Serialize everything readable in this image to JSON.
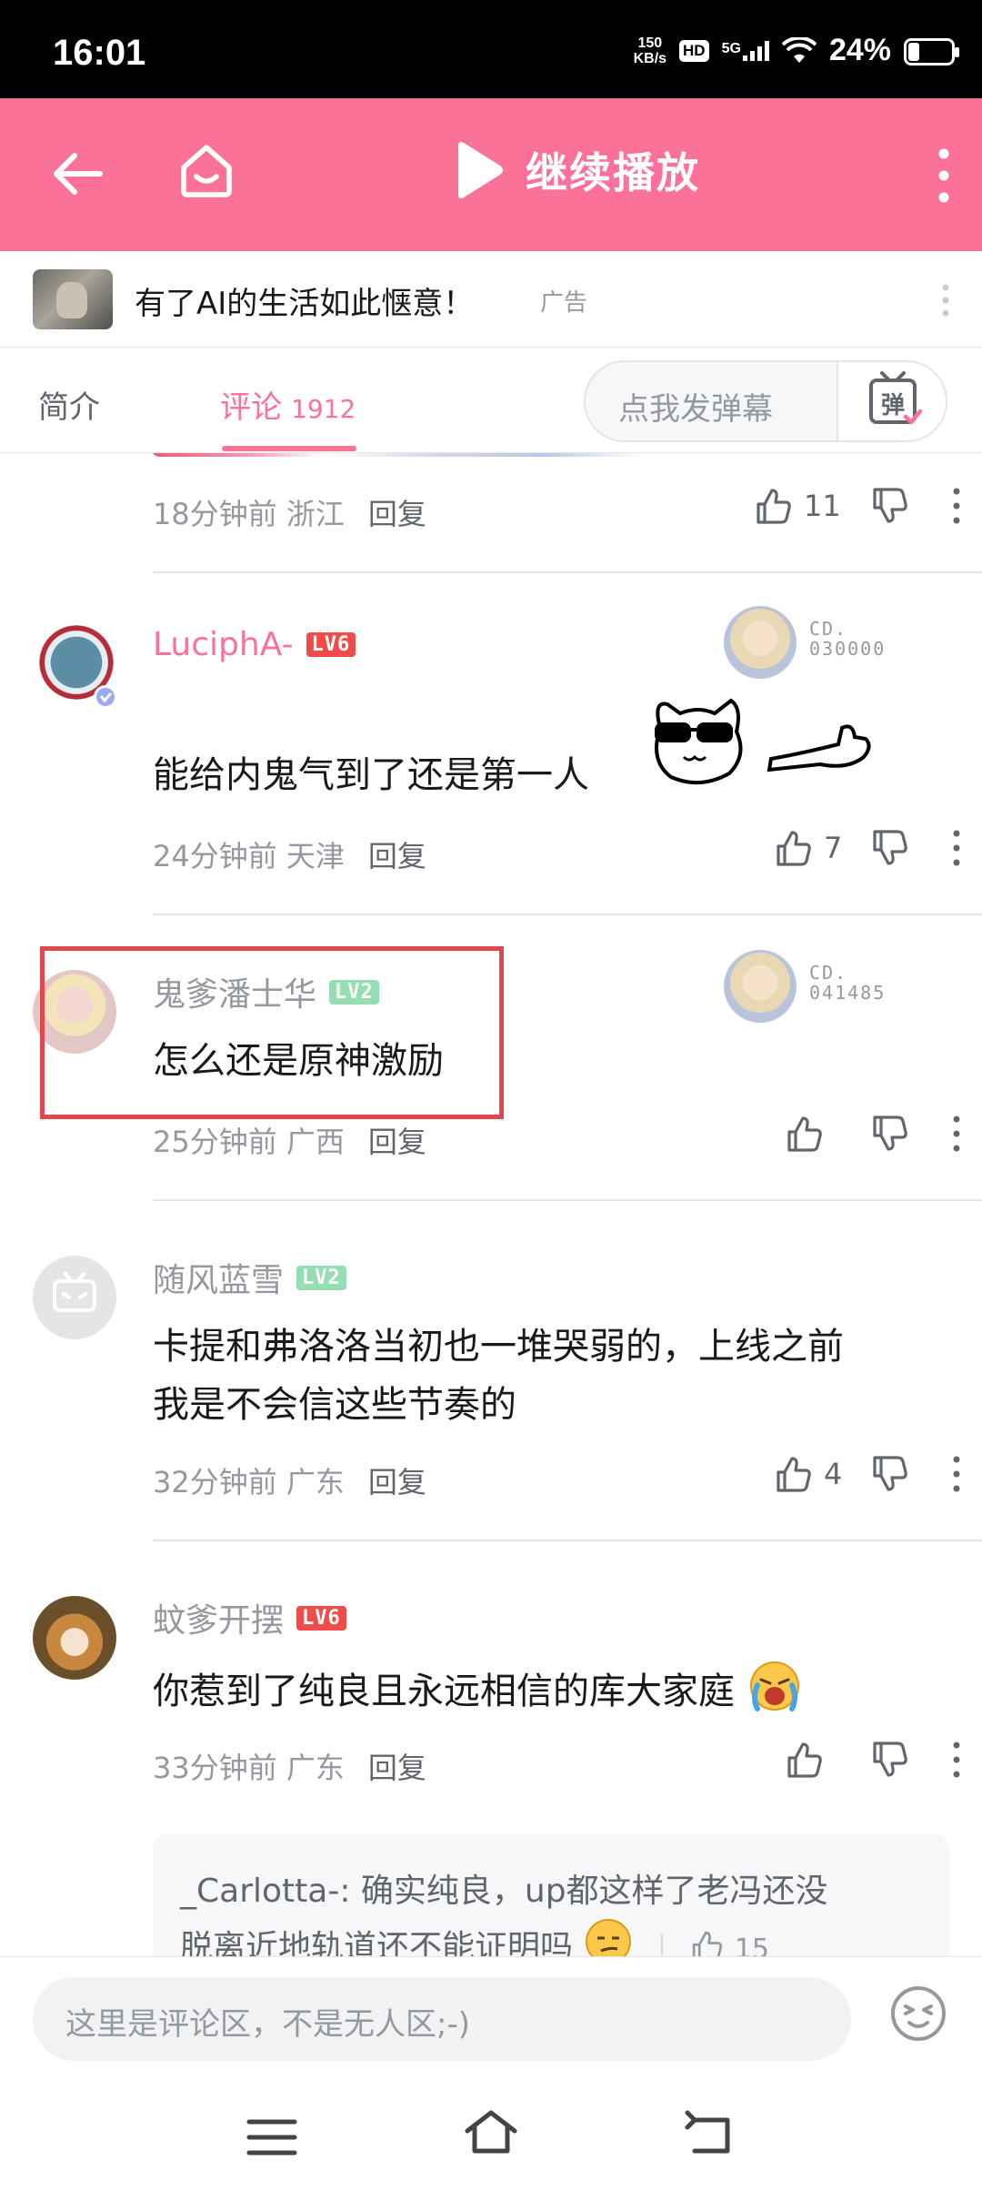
{
  "status_bar": {
    "time": "16:01",
    "net_speed_value": "150",
    "net_speed_unit": "KB/s",
    "hd": "HD",
    "network": "5G",
    "battery": "24%",
    "battery_level": 0.24
  },
  "top_bar": {
    "continue_label": "继续播放",
    "icons": [
      "back-arrow-icon",
      "home-icon",
      "play-icon",
      "more-vertical-icon"
    ]
  },
  "ad": {
    "text": "有了AI的生活如此惬意！",
    "tag": "广告"
  },
  "tabs": {
    "intro": "简介",
    "comments": "评论",
    "comment_count": "1912",
    "danmaku_placeholder": "点我发弹幕",
    "danmaku_button": "弹"
  },
  "comments": [
    {
      "time": "18分钟前 浙江",
      "reply": "回复",
      "likes": "11"
    },
    {
      "username": "LuciphA-",
      "level": "LV6",
      "text": "能给内鬼气到了还是第一人",
      "time": "24分钟前 天津",
      "reply": "回复",
      "likes": "7",
      "fan_no_prefix": "CD.",
      "fan_no": "030000",
      "username_color": "#fb7299"
    },
    {
      "username": "鬼爹潘士华",
      "level": "LV2",
      "text": "怎么还是原神激励",
      "time": "25分钟前 广西",
      "reply": "回复",
      "likes": "",
      "fan_no_prefix": "CD.",
      "fan_no": "041485"
    },
    {
      "username": "随风蓝雪",
      "level": "LV2",
      "text_line1": "卡提和弗洛洛当初也一堆哭弱的，上线之前",
      "text_line2": "我是不会信这些节奏的",
      "time": "32分钟前 广东",
      "reply": "回复",
      "likes": "4"
    },
    {
      "username": "蚊爹开摆",
      "level": "LV6",
      "text": "你惹到了纯良且永远相信的库大家庭",
      "time": "33分钟前 广东",
      "reply": "回复",
      "likes": ""
    }
  ],
  "sub_reply": {
    "user": "_Carlotta-",
    "text_line1": "确实纯良，up都这样了老冯还没",
    "text_line2": "脱离近地轨道还不能证明吗",
    "likes": "15"
  },
  "bottom": {
    "input_placeholder": "这里是评论区，不是无人区;-)"
  },
  "colors": {
    "brand_pink": "#fb7299",
    "highlight_red": "#e0474f",
    "lv6": "#f04c49",
    "lv2": "#95ddb2"
  }
}
